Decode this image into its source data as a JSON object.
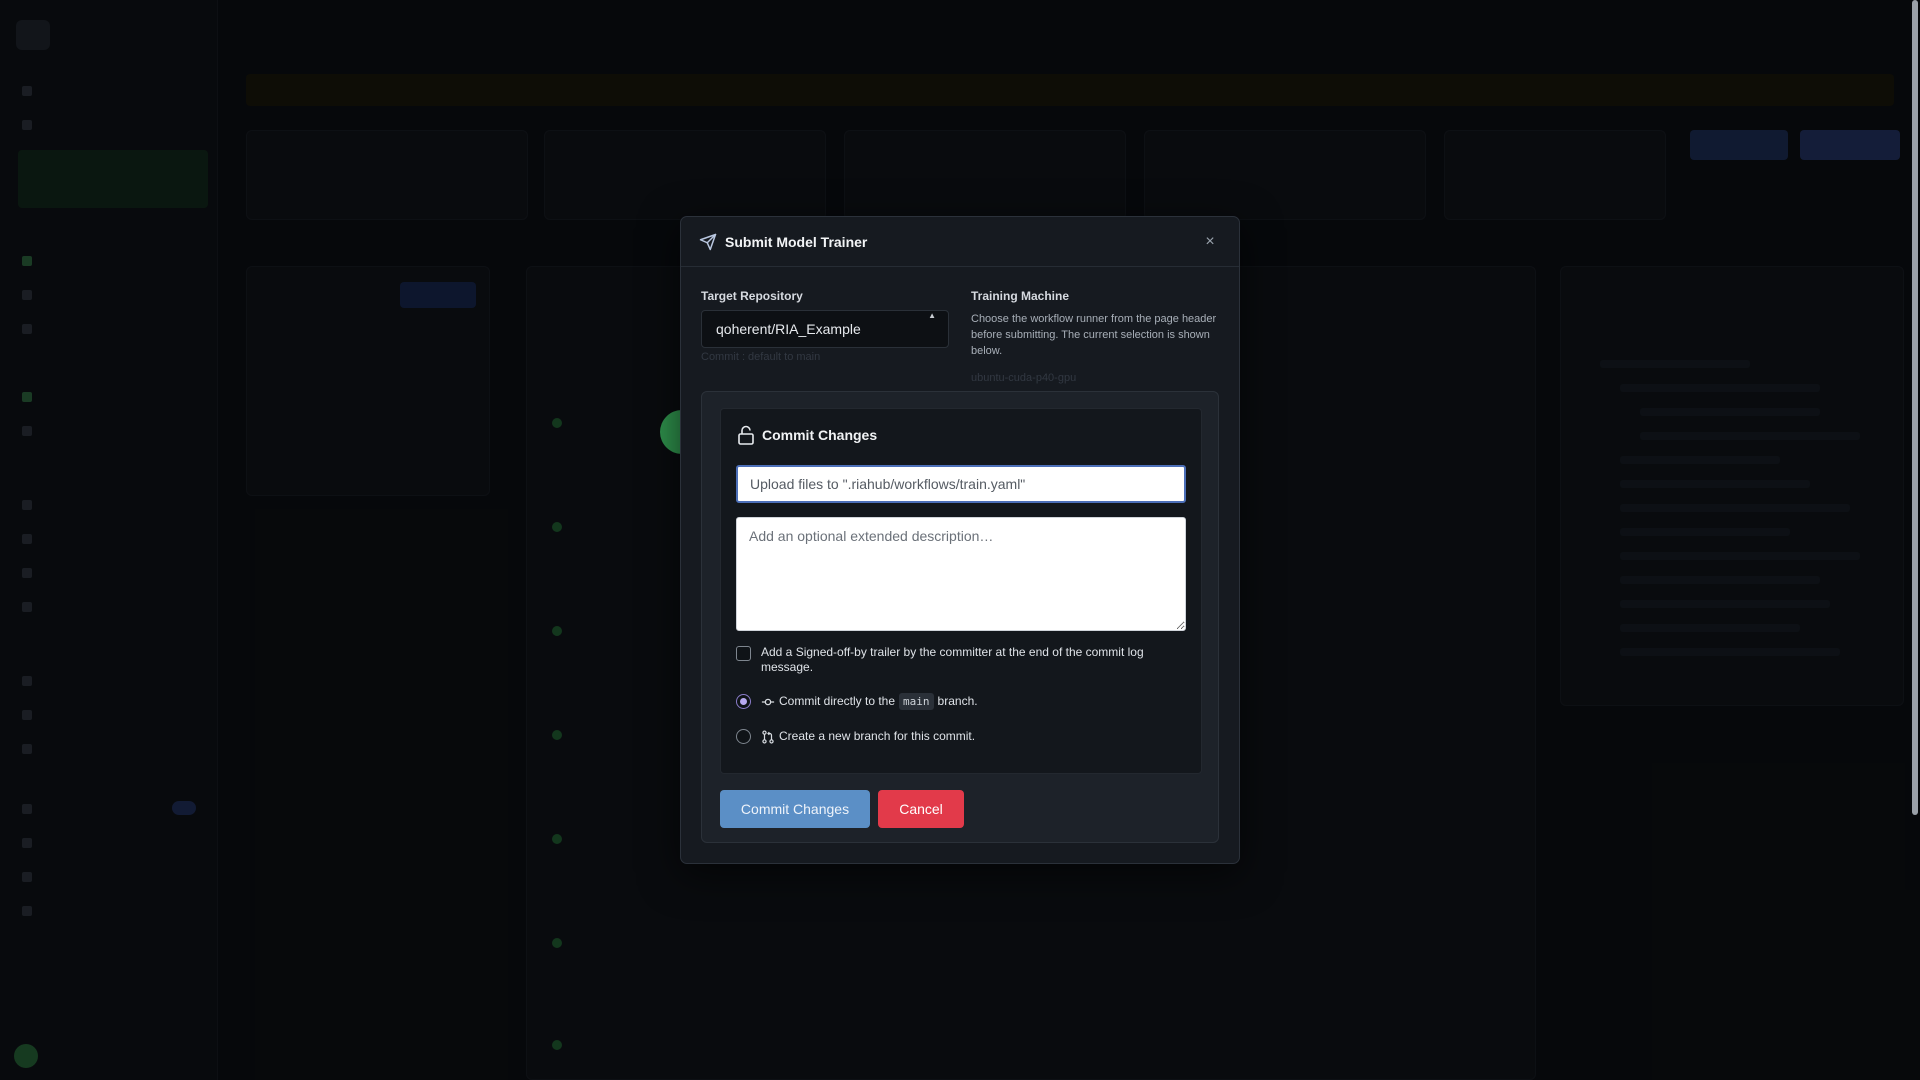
{
  "modal": {
    "title": "Submit Model Trainer",
    "close_label": "×",
    "target_repository": {
      "label": "Target Repository",
      "value": "qoherent/RIA_Example",
      "hint": "Commit : default to main"
    },
    "training_machine": {
      "label": "Training Machine",
      "description": "Choose the workflow runner from the page header before submitting. The current selection is shown below.",
      "current": "ubuntu-cuda-p40-gpu"
    },
    "commit": {
      "title": "Commit Changes",
      "summary_placeholder": "Upload files to \".riahub/workflows/train.yaml\"",
      "description_placeholder": "Add an optional extended description…",
      "signoff_label": "Add a Signed-off-by trailer by the committer at the end of the commit log message.",
      "direct_prefix": "Commit directly to the",
      "branch_name": "main",
      "direct_suffix": "branch.",
      "new_branch_label": "Create a new branch for this commit.",
      "selected_option": "direct",
      "commit_button": "Commit Changes",
      "cancel_button": "Cancel"
    }
  },
  "colors": {
    "commit_button": "#5b8fc6",
    "cancel_button": "#e23a4a",
    "modal_bg": "#161a20",
    "accent_green": "#2e8f4b"
  }
}
